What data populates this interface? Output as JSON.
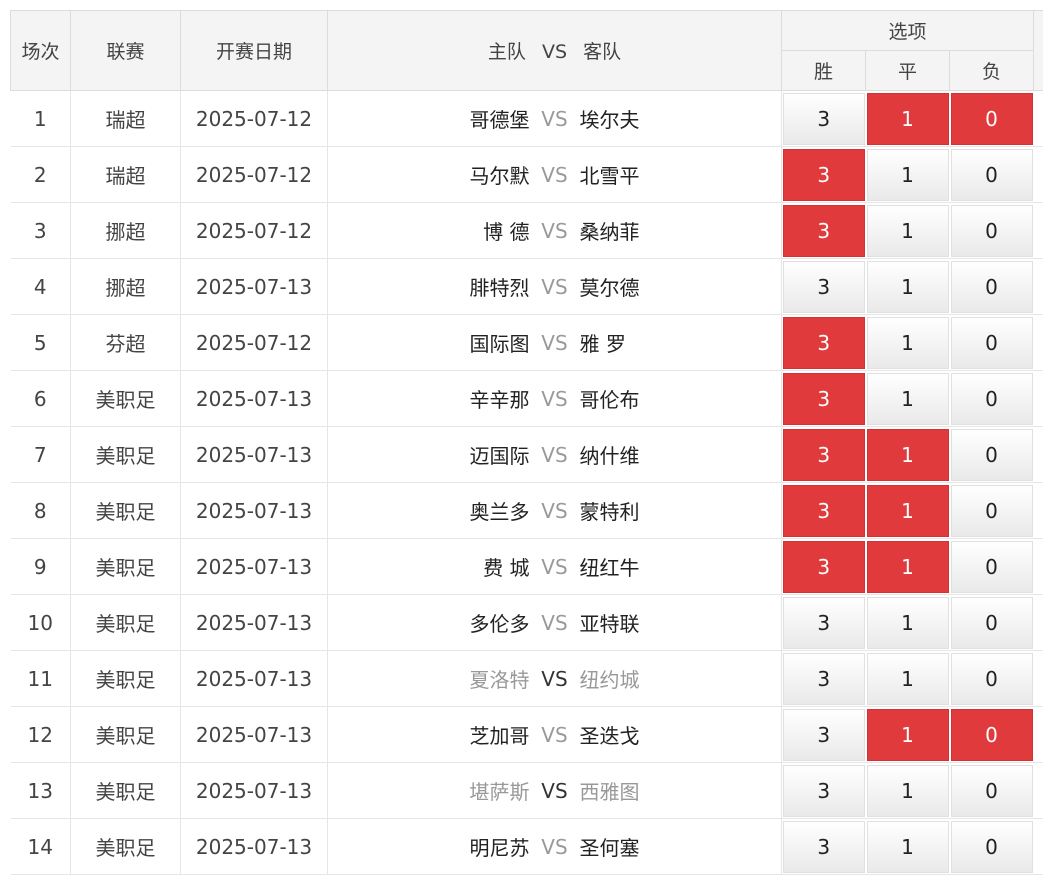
{
  "header": {
    "idx": "场次",
    "league": "联赛",
    "date": "开赛日期",
    "home": "主队",
    "vs": "VS",
    "away": "客队",
    "options": "选项",
    "win": "胜",
    "draw": "平",
    "lose": "负"
  },
  "colors": {
    "selected": "#e03a3c"
  },
  "matches": [
    {
      "idx": "1",
      "league": "瑞超",
      "date": "2025-07-12",
      "home": "哥德堡",
      "vs": "VS",
      "away": "埃尔夫",
      "muted": false,
      "opts": [
        {
          "label": "3",
          "sel": false
        },
        {
          "label": "1",
          "sel": true
        },
        {
          "label": "0",
          "sel": true
        }
      ]
    },
    {
      "idx": "2",
      "league": "瑞超",
      "date": "2025-07-12",
      "home": "马尔默",
      "vs": "VS",
      "away": "北雪平",
      "muted": false,
      "opts": [
        {
          "label": "3",
          "sel": true
        },
        {
          "label": "1",
          "sel": false
        },
        {
          "label": "0",
          "sel": false
        }
      ]
    },
    {
      "idx": "3",
      "league": "挪超",
      "date": "2025-07-12",
      "home": "博 德",
      "vs": "VS",
      "away": "桑纳菲",
      "muted": false,
      "opts": [
        {
          "label": "3",
          "sel": true
        },
        {
          "label": "1",
          "sel": false
        },
        {
          "label": "0",
          "sel": false
        }
      ]
    },
    {
      "idx": "4",
      "league": "挪超",
      "date": "2025-07-13",
      "home": "腓特烈",
      "vs": "VS",
      "away": "莫尔德",
      "muted": false,
      "opts": [
        {
          "label": "3",
          "sel": false
        },
        {
          "label": "1",
          "sel": false
        },
        {
          "label": "0",
          "sel": false
        }
      ]
    },
    {
      "idx": "5",
      "league": "芬超",
      "date": "2025-07-12",
      "home": "国际图",
      "vs": "VS",
      "away": "雅 罗",
      "muted": false,
      "opts": [
        {
          "label": "3",
          "sel": true
        },
        {
          "label": "1",
          "sel": false
        },
        {
          "label": "0",
          "sel": false
        }
      ]
    },
    {
      "idx": "6",
      "league": "美职足",
      "date": "2025-07-13",
      "home": "辛辛那",
      "vs": "VS",
      "away": "哥伦布",
      "muted": false,
      "opts": [
        {
          "label": "3",
          "sel": true
        },
        {
          "label": "1",
          "sel": false
        },
        {
          "label": "0",
          "sel": false
        }
      ]
    },
    {
      "idx": "7",
      "league": "美职足",
      "date": "2025-07-13",
      "home": "迈国际",
      "vs": "VS",
      "away": "纳什维",
      "muted": false,
      "opts": [
        {
          "label": "3",
          "sel": true
        },
        {
          "label": "1",
          "sel": true
        },
        {
          "label": "0",
          "sel": false
        }
      ]
    },
    {
      "idx": "8",
      "league": "美职足",
      "date": "2025-07-13",
      "home": "奥兰多",
      "vs": "VS",
      "away": "蒙特利",
      "muted": false,
      "opts": [
        {
          "label": "3",
          "sel": true
        },
        {
          "label": "1",
          "sel": true
        },
        {
          "label": "0",
          "sel": false
        }
      ]
    },
    {
      "idx": "9",
      "league": "美职足",
      "date": "2025-07-13",
      "home": "费 城",
      "vs": "VS",
      "away": "纽红牛",
      "muted": false,
      "opts": [
        {
          "label": "3",
          "sel": true
        },
        {
          "label": "1",
          "sel": true
        },
        {
          "label": "0",
          "sel": false
        }
      ]
    },
    {
      "idx": "10",
      "league": "美职足",
      "date": "2025-07-13",
      "home": "多伦多",
      "vs": "VS",
      "away": "亚特联",
      "muted": false,
      "opts": [
        {
          "label": "3",
          "sel": false
        },
        {
          "label": "1",
          "sel": false
        },
        {
          "label": "0",
          "sel": false
        }
      ]
    },
    {
      "idx": "11",
      "league": "美职足",
      "date": "2025-07-13",
      "home": "夏洛特",
      "vs": "VS",
      "away": "纽约城",
      "muted": true,
      "opts": [
        {
          "label": "3",
          "sel": false
        },
        {
          "label": "1",
          "sel": false
        },
        {
          "label": "0",
          "sel": false
        }
      ]
    },
    {
      "idx": "12",
      "league": "美职足",
      "date": "2025-07-13",
      "home": "芝加哥",
      "vs": "VS",
      "away": "圣迭戈",
      "muted": false,
      "opts": [
        {
          "label": "3",
          "sel": false
        },
        {
          "label": "1",
          "sel": true
        },
        {
          "label": "0",
          "sel": true
        }
      ]
    },
    {
      "idx": "13",
      "league": "美职足",
      "date": "2025-07-13",
      "home": "堪萨斯",
      "vs": "VS",
      "away": "西雅图",
      "muted": true,
      "opts": [
        {
          "label": "3",
          "sel": false
        },
        {
          "label": "1",
          "sel": false
        },
        {
          "label": "0",
          "sel": false
        }
      ]
    },
    {
      "idx": "14",
      "league": "美职足",
      "date": "2025-07-13",
      "home": "明尼苏",
      "vs": "VS",
      "away": "圣何塞",
      "muted": false,
      "opts": [
        {
          "label": "3",
          "sel": false
        },
        {
          "label": "1",
          "sel": false
        },
        {
          "label": "0",
          "sel": false
        }
      ]
    }
  ]
}
